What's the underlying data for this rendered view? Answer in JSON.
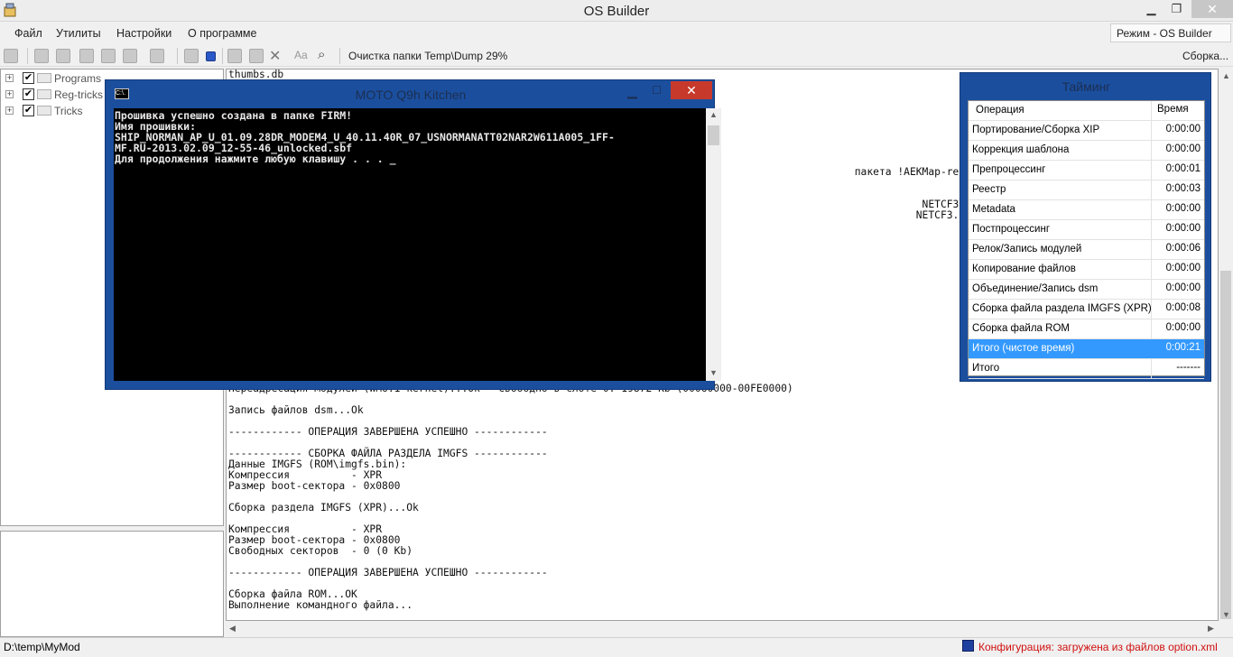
{
  "window": {
    "title": "OS Builder",
    "min": "▁",
    "max": "❐",
    "close": "✕"
  },
  "menu": {
    "items": [
      "Файл",
      "Утилиты",
      "Настройки",
      "О программе"
    ],
    "mode": "Режим - OS Builder"
  },
  "toolbar": {
    "status": "Очистка папки Temp\\Dump  29%",
    "build": "Сборка..."
  },
  "tree": {
    "items": [
      {
        "label": "Programs",
        "checked": "✔"
      },
      {
        "label": "Reg-tricks",
        "checked": "✔"
      },
      {
        "label": "Tricks",
        "checked": "✔"
      }
    ]
  },
  "log": {
    "lines": [
      "thumbs.db",
      "",
      "",
      "",
      "",
      "",
      "",
      "",
      "",
      "                                                                                                      пакета !AEKMap-repacked",
      "",
      "",
      "                                                                                                                 NETCF3.5",
      "                                                                                                                NETCF3.5",
      "",
      "",
      "",
      "",
      "",
      "",
      "",
      "",
      "",
      "",
      "",
      "",
      "",
      "",
      "",
      "Переадресация модулей (WM6.1 kernel)...Ok   Свободно в слоте 0: 19872 Kb (00060000-00FE0000)",
      "",
      "Запись файлов dsm...Ok",
      "",
      "------------ ОПЕРАЦИЯ ЗАВЕРШЕНА УСПЕШНО ------------",
      "",
      "------------ СБОРКА ФАЙЛА РАЗДЕЛА IMGFS ------------",
      "Данные IMGFS (ROM\\imgfs.bin):",
      "Компрессия          - XPR",
      "Размер boot-сектора - 0x0800",
      "",
      "Сборка раздела IMGFS (XPR)...Ok",
      "",
      "Компрессия          - XPR",
      "Размер boot-сектора - 0x0800",
      "Свободных секторов  - 0 (0 Kb)",
      "",
      "------------ ОПЕРАЦИЯ ЗАВЕРШЕНА УСПЕШНО ------------",
      "",
      "Сборка файла ROM...OK",
      "Выполнение командного файла..."
    ]
  },
  "console": {
    "title": "MOTO Q9h Kitchen",
    "icon_text": "C:\\.",
    "lines": [
      "Прошивка успешно создана в папке FIRM!",
      "Имя прошивки:",
      "SHIP_NORMAN_AP_U_01.09.28DR_MODEM4_U_40.11.40R_07_USNORMANATT02NAR2W611A005_1FF-",
      "MF.RU-2013.02.09_12-55-46_unlocked.sbf",
      "Для продолжения нажмите любую клавишу . . . _"
    ]
  },
  "timing": {
    "title": "Тайминг",
    "header": {
      "op": "Операция",
      "time": "Время"
    },
    "rows": [
      {
        "op": "Портирование/Сборка XIP",
        "time": "0:00:00"
      },
      {
        "op": "Коррекция шаблона",
        "time": "0:00:00"
      },
      {
        "op": "Препроцессинг",
        "time": "0:00:01"
      },
      {
        "op": "Реестр",
        "time": "0:00:03"
      },
      {
        "op": "Metadata",
        "time": "0:00:00"
      },
      {
        "op": "Постпроцессинг",
        "time": "0:00:00"
      },
      {
        "op": "Релок/Запись модулей",
        "time": "0:00:06"
      },
      {
        "op": "Копирование файлов",
        "time": "0:00:00"
      },
      {
        "op": "Объединение/Запись dsm",
        "time": "0:00:00"
      },
      {
        "op": "Сборка файла раздела IMGFS (XPR)",
        "time": "0:00:08"
      },
      {
        "op": "Сборка файла ROM",
        "time": "0:00:00"
      },
      {
        "op": "Итого (чистое время)",
        "time": "0:00:21"
      },
      {
        "op": "Итого",
        "time": "-------"
      }
    ]
  },
  "status": {
    "path": "D:\\temp\\MyMod",
    "config": "Конфигурация: загружена из файлов option.xml"
  }
}
